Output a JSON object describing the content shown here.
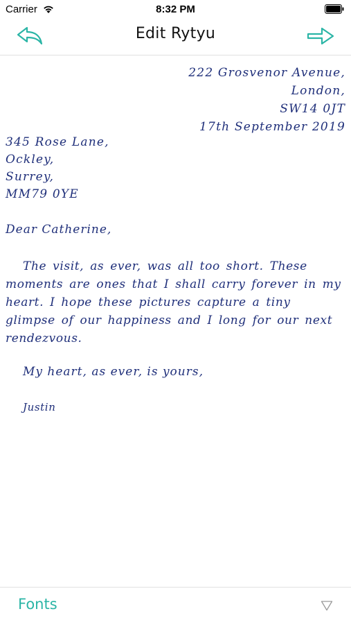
{
  "status_bar": {
    "carrier": "Carrier",
    "time": "8:32 PM",
    "wifi_icon": "wifi-icon",
    "battery_icon": "battery-icon"
  },
  "nav": {
    "title": "Edit Rytyu",
    "back_icon": "undo-arrow-icon",
    "forward_icon": "forward-arrow-icon",
    "accent_color": "#2bb5a6"
  },
  "letter": {
    "ink_color": "#1f2f7a",
    "sender_address": [
      "222 Grosvenor Avenue,",
      "London,",
      "SW14 0JT",
      "17th September 2019"
    ],
    "recipient_address": [
      "345 Rose Lane,",
      "Ockley,",
      "Surrey,",
      "MM79 0YE"
    ],
    "greeting": "Dear Catherine,",
    "body": "The visit, as ever, was all too short. These moments are ones that I shall carry forever in my heart. I hope these pictures capture a tiny glimpse of our happiness and I long for our next rendezvous.",
    "closing": "My heart, as ever, is yours,",
    "signature": "Justin"
  },
  "toolbar": {
    "fonts_label": "Fonts",
    "dropdown_icon": "triangle-down-icon"
  }
}
